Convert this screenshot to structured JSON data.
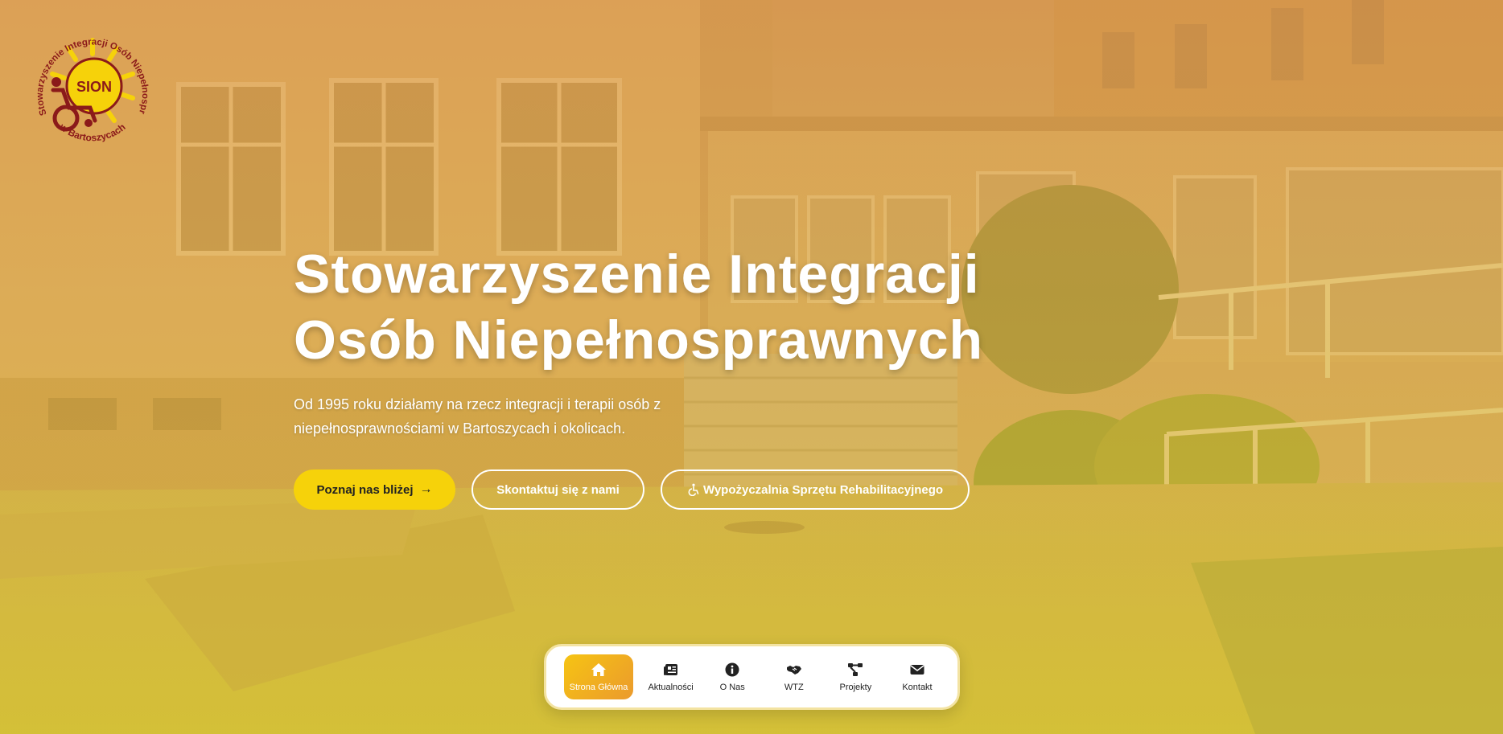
{
  "logo": {
    "name": "SION",
    "ring_text": "Stowarzyszenie Integracji Osób Niepełnosprawnych",
    "bottom_text": "w Bartoszycach"
  },
  "hero": {
    "title_line1": "Stowarzyszenie Integracji",
    "title_line2": "Osób Niepełnosprawnych",
    "description": "Od 1995 roku działamy na rzecz integracji i terapii osób z niepełnosprawnościami w Bartoszycach i okolicach."
  },
  "buttons": {
    "learn_more": "Poznaj nas bliżej",
    "contact": "Skontaktuj się z nami",
    "rental": "Wypożyczalnia Sprzętu Rehabilitacyjnego"
  },
  "nav": {
    "items": [
      {
        "label": "Strona Główna",
        "icon": "home-icon",
        "active": true
      },
      {
        "label": "Aktualności",
        "icon": "newspaper-icon",
        "active": false
      },
      {
        "label": "O Nas",
        "icon": "info-icon",
        "active": false
      },
      {
        "label": "WTZ",
        "icon": "handshake-icon",
        "active": false
      },
      {
        "label": "Projekty",
        "icon": "project-diagram-icon",
        "active": false
      },
      {
        "label": "Kontakt",
        "icon": "envelope-icon",
        "active": false
      }
    ]
  },
  "colors": {
    "accent_yellow": "#f6d20a",
    "logo_maroon": "#8b1a1a",
    "nav_active_start": "#f6c413",
    "nav_active_end": "#eb9a2d"
  }
}
